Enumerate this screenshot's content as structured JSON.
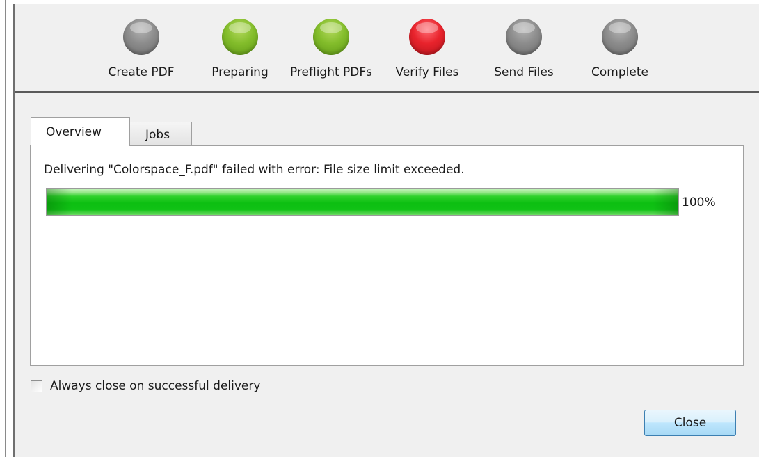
{
  "steps": [
    {
      "label": "Create PDF",
      "status": "pending",
      "color": "#8c8c8c"
    },
    {
      "label": "Preparing",
      "status": "done",
      "color": "#83bd2b"
    },
    {
      "label": "Preflight PDFs",
      "status": "done",
      "color": "#83bd2b"
    },
    {
      "label": "Verify Files",
      "status": "error",
      "color": "#e8232c"
    },
    {
      "label": "Send Files",
      "status": "pending",
      "color": "#8c8c8c"
    },
    {
      "label": "Complete",
      "status": "pending",
      "color": "#8c8c8c"
    }
  ],
  "tabs": [
    {
      "label": "Overview",
      "selected": true
    },
    {
      "label": "Jobs",
      "selected": false
    }
  ],
  "overview": {
    "message": "Delivering \"Colorspace_F.pdf\" failed with error: File size limit exceeded.",
    "progress_value": 1.0,
    "progress_text": "100%",
    "progress_color": "#10c215"
  },
  "options": {
    "always_close_label": "Always close on successful delivery",
    "always_close_checked": false
  },
  "buttons": {
    "close_label": "Close"
  }
}
